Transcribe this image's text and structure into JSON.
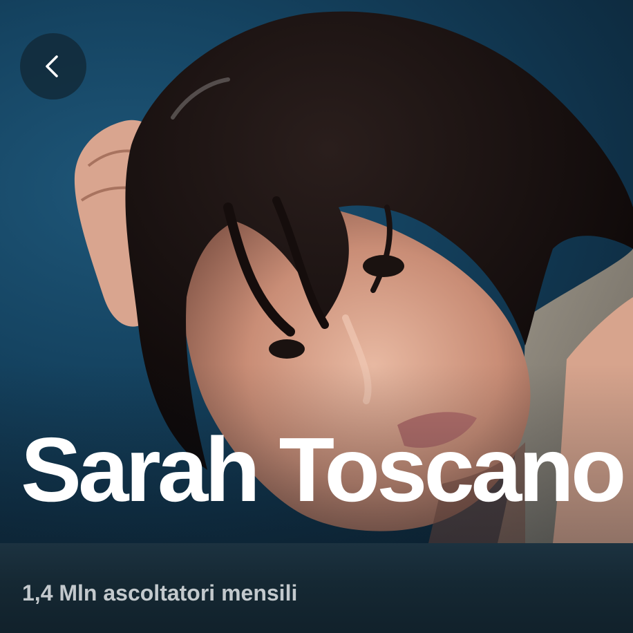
{
  "artist": {
    "name": "Sarah Toscano",
    "monthly_listeners": "1,4 Mln ascoltatori mensili"
  },
  "header": {
    "back_icon": "chevron-left-icon"
  },
  "colors": {
    "hero_background": "#154462",
    "info_bar_background": "#152833",
    "name_text": "#ffffff",
    "listeners_text": "#c3c9cd",
    "back_button_background": "#122a3a"
  }
}
